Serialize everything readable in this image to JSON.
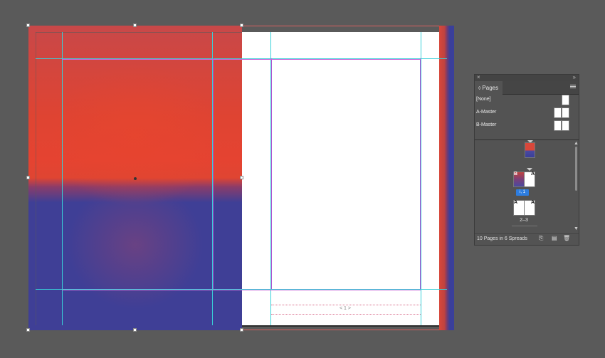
{
  "document": {
    "page_number_marker": "< 1 >"
  },
  "pages_panel": {
    "tab_label": "Pages",
    "masters": [
      {
        "label": "[None]",
        "pages": 1
      },
      {
        "label": "A-Master",
        "pages": 2
      },
      {
        "label": "B-Master",
        "pages": 2
      }
    ],
    "spreads": [
      {
        "label": "",
        "left_master": "",
        "right_master": ""
      },
      {
        "label": "i, 1",
        "left_master": "B",
        "right_master": "A",
        "selected": true
      },
      {
        "label": "2–3",
        "left_master": "A",
        "right_master": "A"
      }
    ],
    "footer_text": "10 Pages in 6 Spreads",
    "icons": [
      "close-icon",
      "collapse-icon",
      "panel-menu-icon",
      "edit-page-size-icon",
      "new-page-icon",
      "delete-page-icon"
    ]
  }
}
